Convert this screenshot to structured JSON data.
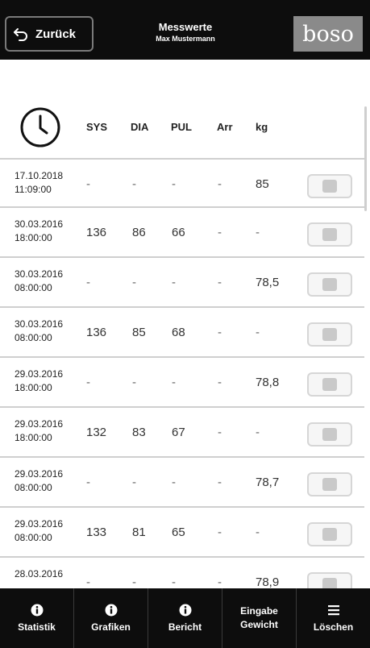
{
  "header": {
    "back_label": "Zurück",
    "title": "Messwerte",
    "subtitle": "Max Mustermann",
    "logo_text": "boso"
  },
  "columns": [
    "SYS",
    "DIA",
    "PUL",
    "Arr",
    "kg"
  ],
  "rows": [
    {
      "date": "17.10.2018",
      "time": "11:09:00",
      "sys": "-",
      "dia": "-",
      "pul": "-",
      "arr": "-",
      "kg": "85"
    },
    {
      "date": "30.03.2016",
      "time": "18:00:00",
      "sys": "136",
      "dia": "86",
      "pul": "66",
      "arr": "-",
      "kg": "-"
    },
    {
      "date": "30.03.2016",
      "time": "08:00:00",
      "sys": "-",
      "dia": "-",
      "pul": "-",
      "arr": "-",
      "kg": "78,5"
    },
    {
      "date": "30.03.2016",
      "time": "08:00:00",
      "sys": "136",
      "dia": "85",
      "pul": "68",
      "arr": "-",
      "kg": "-"
    },
    {
      "date": "29.03.2016",
      "time": "18:00:00",
      "sys": "-",
      "dia": "-",
      "pul": "-",
      "arr": "-",
      "kg": "78,8"
    },
    {
      "date": "29.03.2016",
      "time": "18:00:00",
      "sys": "132",
      "dia": "83",
      "pul": "67",
      "arr": "-",
      "kg": "-"
    },
    {
      "date": "29.03.2016",
      "time": "08:00:00",
      "sys": "-",
      "dia": "-",
      "pul": "-",
      "arr": "-",
      "kg": "78,7"
    },
    {
      "date": "29.03.2016",
      "time": "08:00:00",
      "sys": "133",
      "dia": "81",
      "pul": "65",
      "arr": "-",
      "kg": "-"
    },
    {
      "date": "28.03.2016",
      "time": "",
      "sys": "-",
      "dia": "-",
      "pul": "-",
      "arr": "-",
      "kg": "78,9"
    }
  ],
  "footer": {
    "buttons": [
      {
        "line1": "Statistik",
        "line2": "",
        "icon": "info-icon"
      },
      {
        "line1": "Grafiken",
        "line2": "",
        "icon": "info-icon"
      },
      {
        "line1": "Bericht",
        "line2": "",
        "icon": "info-icon"
      },
      {
        "line1": "Eingabe",
        "line2": "Gewicht",
        "icon": ""
      },
      {
        "line1": "Löschen",
        "line2": "",
        "icon": "menu-icon"
      }
    ]
  }
}
